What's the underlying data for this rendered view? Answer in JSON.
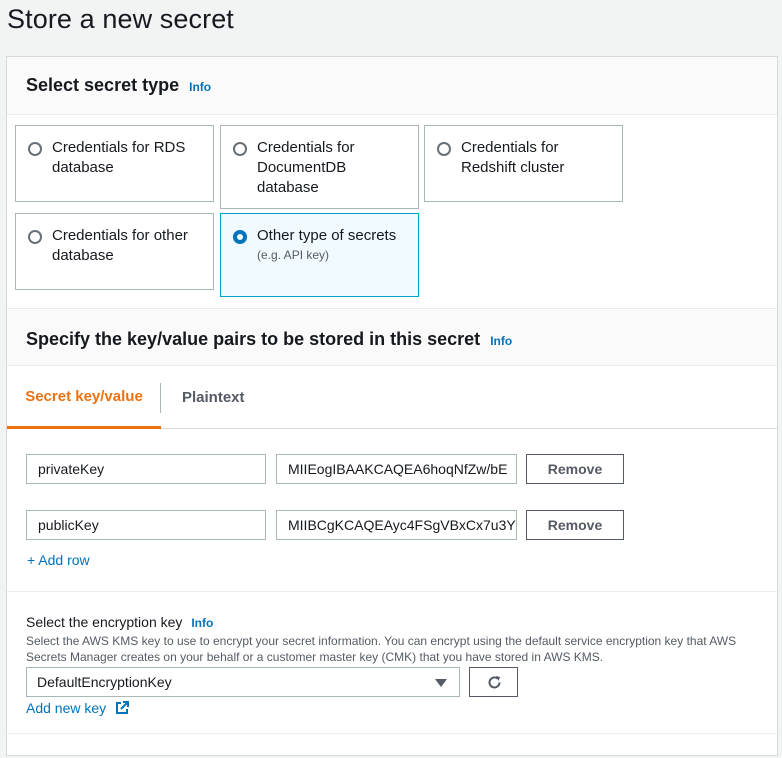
{
  "page": {
    "title": "Store a new secret"
  },
  "secret_type": {
    "title": "Select secret type",
    "info": "Info",
    "options": [
      {
        "label": "Credentials for RDS database",
        "sub": "",
        "selected": false
      },
      {
        "label": "Credentials for DocumentDB database",
        "sub": "",
        "selected": false
      },
      {
        "label": "Credentials for Redshift cluster",
        "sub": "",
        "selected": false
      },
      {
        "label": "Credentials for other database",
        "sub": "",
        "selected": false
      },
      {
        "label": "Other type of secrets",
        "sub": "(e.g. API key)",
        "selected": true
      }
    ]
  },
  "kv_section": {
    "title": "Specify the key/value pairs to be stored in this secret",
    "info": "Info",
    "tabs": [
      {
        "label": "Secret key/value",
        "active": true
      },
      {
        "label": "Plaintext",
        "active": false
      }
    ],
    "rows": [
      {
        "key": "privateKey",
        "value": "MIIEogIBAAKCAQEA6hoqNfZw/bE",
        "remove_label": "Remove"
      },
      {
        "key": "publicKey",
        "value": "MIIBCgKCAQEAyc4FSgVBxCx7u3Y",
        "remove_label": "Remove"
      }
    ],
    "add_row": "+ Add row"
  },
  "encryption": {
    "label": "Select the encryption key",
    "info": "Info",
    "description": "Select the AWS KMS key to use to encrypt your secret information. You can encrypt using the default service encryption key that AWS Secrets Manager creates on your behalf or a customer master key (CMK) that you have stored in AWS KMS.",
    "selected": "DefaultEncryptionKey",
    "add_key": "Add new key"
  },
  "colors": {
    "link": "#0073bb",
    "accent": "#ec7211",
    "selected_bg": "#f1faff"
  },
  "icons": {
    "select_caret": "caret-down-icon",
    "refresh": "refresh-icon",
    "external": "external-link-icon"
  }
}
